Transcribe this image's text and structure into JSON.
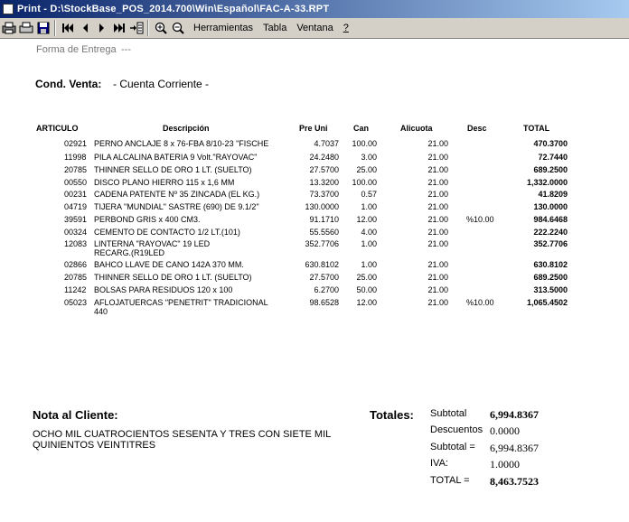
{
  "window": {
    "title": "Print - D:\\StockBase_POS_2014.700\\Win\\Español\\FAC-A-33.RPT"
  },
  "toolbar": {
    "menu": [
      {
        "label": "Herramientas",
        "ul": "H"
      },
      {
        "label": "Tabla",
        "ul": "T"
      },
      {
        "label": "Ventana",
        "ul": "V"
      },
      {
        "label": "?",
        "ul": "?"
      }
    ]
  },
  "invoice": {
    "forma_entrega_label": "Forma de Entrega",
    "forma_entrega_value": "---",
    "cond_venta_label": "Cond. Venta:",
    "cond_venta_value": "- Cuenta Corriente -",
    "headers": {
      "articulo": "ARTICULO",
      "descripcion": "Descripción",
      "pre_uni": "Pre Uni",
      "can": "Can",
      "alicuota": "Alicuota",
      "desc": "Desc",
      "total": "TOTAL"
    },
    "items": [
      {
        "code": "02921",
        "desc": "PERNO ANCLAJE 8 x 76-FBA 8/10-23 \"FISCHE",
        "desc2": "",
        "pre": "4.7037",
        "can": "100.00",
        "ali": "21.00",
        "dsc": "",
        "total": "470.3700"
      },
      {
        "code": "11998",
        "desc": "PILA ALCALINA BATERIA 9 Volt.\"RAYOVAC\"",
        "desc2": "",
        "pre": "24.2480",
        "can": "3.00",
        "ali": "21.00",
        "dsc": "",
        "total": "72.7440"
      },
      {
        "code": "20785",
        "desc": "THINNER SELLO DE ORO 1 LT. (SUELTO)",
        "desc2": "",
        "pre": "27.5700",
        "can": "25.00",
        "ali": "21.00",
        "dsc": "",
        "total": "689.2500"
      },
      {
        "code": "00550",
        "desc": "DISCO PLANO HIERRO 115 x 1,6 MM",
        "desc2": "",
        "pre": "13.3200",
        "can": "100.00",
        "ali": "21.00",
        "dsc": "",
        "total": "1,332.0000"
      },
      {
        "code": "00231",
        "desc": "CADENA PATENTE Nº 35 ZINCADA  (EL KG.)",
        "desc2": "",
        "pre": "73.3700",
        "can": "0.57",
        "ali": "21.00",
        "dsc": "",
        "total": "41.8209"
      },
      {
        "code": "04719",
        "desc": "TIJERA \"MUNDIAL\" SASTRE (690) DE 9.1/2\"",
        "desc2": "",
        "pre": "130.0000",
        "can": "1.00",
        "ali": "21.00",
        "dsc": "",
        "total": "130.0000"
      },
      {
        "code": "39591",
        "desc": "PERBOND GRIS x 400 CM3.",
        "desc2": "",
        "pre": "91.1710",
        "can": "12.00",
        "ali": "21.00",
        "dsc": "%10.00",
        "total": "984.6468"
      },
      {
        "code": "00324",
        "desc": "CEMENTO DE CONTACTO 1/2 LT.(101)",
        "desc2": "",
        "pre": "55.5560",
        "can": "4.00",
        "ali": "21.00",
        "dsc": "",
        "total": "222.2240"
      },
      {
        "code": "12083",
        "desc": "LINTERNA \"RAYOVAC\" 19 LED",
        "desc2": "RECARG.(R19LED",
        "pre": "352.7706",
        "can": "1.00",
        "ali": "21.00",
        "dsc": "",
        "total": "352.7706"
      },
      {
        "code": "02866",
        "desc": "BAHCO LLAVE DE CANO 142A  370 MM.",
        "desc2": "",
        "pre": "630.8102",
        "can": "1.00",
        "ali": "21.00",
        "dsc": "",
        "total": "630.8102"
      },
      {
        "code": "20785",
        "desc": "THINNER SELLO DE ORO 1 LT. (SUELTO)",
        "desc2": "",
        "pre": "27.5700",
        "can": "25.00",
        "ali": "21.00",
        "dsc": "",
        "total": "689.2500"
      },
      {
        "code": "11242",
        "desc": "BOLSAS PARA RESIDUOS 120 x 100",
        "desc2": "",
        "pre": "6.2700",
        "can": "50.00",
        "ali": "21.00",
        "dsc": "",
        "total": "313.5000"
      },
      {
        "code": "05023",
        "desc": "AFLOJATUERCAS \"PENETRIT\" TRADICIONAL",
        "desc2": "440",
        "pre": "98.6528",
        "can": "12.00",
        "ali": "21.00",
        "dsc": "%10.00",
        "total": "1,065.4502"
      }
    ],
    "nota_label": "Nota al Cliente:",
    "nota_line1": "OCHO MIL CUATROCIENTOS SESENTA Y TRES CON SIETE MIL",
    "nota_line2": "QUINIENTOS VEINTITRES",
    "totales_label": "Totales:",
    "totals": [
      {
        "label": "Subtotal",
        "value": "6,994.8367",
        "bold": true
      },
      {
        "label": "Descuentos",
        "value": "0.0000",
        "bold": false
      },
      {
        "label": "Subtotal =",
        "value": "6,994.8367",
        "bold": false
      },
      {
        "label": "IVA:",
        "value": "1.0000",
        "bold": false
      },
      {
        "label": "TOTAL =",
        "value": "8,463.7523",
        "bold": true
      }
    ]
  }
}
